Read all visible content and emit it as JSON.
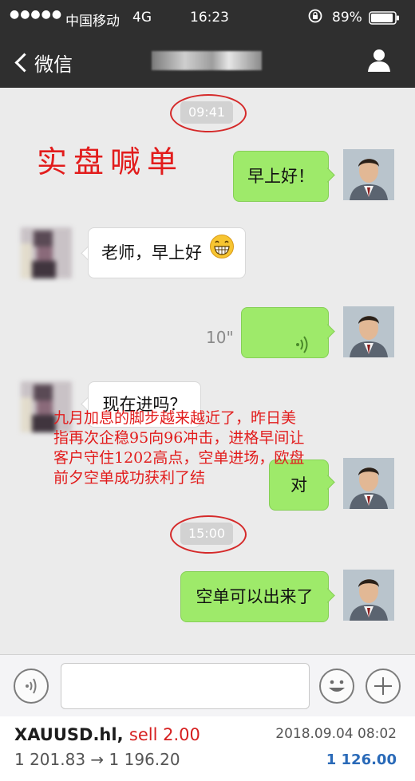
{
  "status_bar": {
    "signal": "●●●●●",
    "carrier": "中国移动",
    "network": "4G",
    "time": "16:23",
    "battery": "89%"
  },
  "nav": {
    "back_label": "微信"
  },
  "chat": {
    "timestamps": [
      "09:41",
      "15:00"
    ],
    "overlay_title": "实盘喊单",
    "messages": [
      {
        "side": "right",
        "type": "text",
        "text": "早上好！"
      },
      {
        "side": "left",
        "type": "text",
        "text": "老师，早上好"
      },
      {
        "side": "right",
        "type": "voice",
        "duration": "10\""
      },
      {
        "side": "left",
        "type": "text",
        "text": "现在进吗？"
      },
      {
        "side": "right",
        "type": "text",
        "text": "对"
      },
      {
        "side": "right",
        "type": "text",
        "text": "空单可以出来了"
      }
    ],
    "overlay_lines": [
      "九月加息的脚步越来越近了，昨日美",
      "指再次企稳95向96冲击，进格早间让",
      "客户守住1202高点，空单进场，欧盘",
      "前夕空单成功获利了结"
    ]
  },
  "footer": {
    "symbol": "XAUUSD.hl,",
    "side": "sell 2.00",
    "prices": "1 201.83 → 1 196.20",
    "date": "2018.09.04 08:02",
    "profit": "1 126.00"
  },
  "colors": {
    "bar_bg": "#2f2f2f",
    "chat_bg": "#ebebeb",
    "green_bubble": "#9eea6a",
    "red_text": "#e21c1c",
    "profit_blue": "#2a6ab8"
  }
}
